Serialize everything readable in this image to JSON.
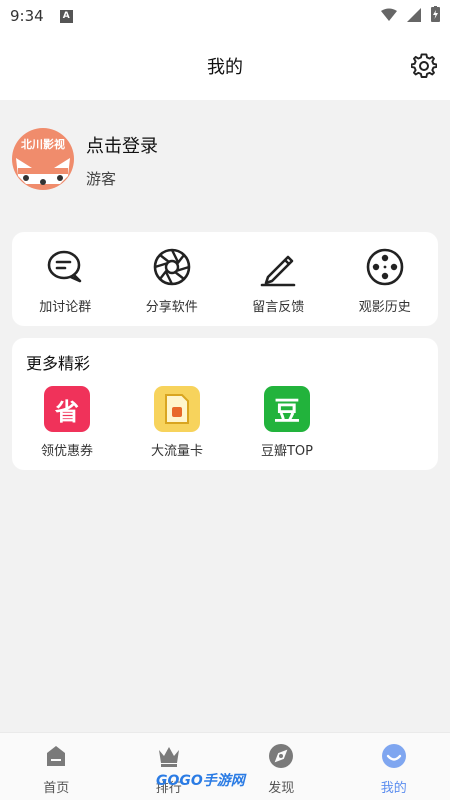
{
  "status": {
    "time": "9:34",
    "notif": "A"
  },
  "header": {
    "title": "我的"
  },
  "profile": {
    "avatar_text": "北川影视",
    "login": "点击登录",
    "guest": "游客"
  },
  "tools": [
    {
      "label": "加讨论群",
      "icon": "chat-icon"
    },
    {
      "label": "分享软件",
      "icon": "aperture-icon"
    },
    {
      "label": "留言反馈",
      "icon": "pencil-icon"
    },
    {
      "label": "观影历史",
      "icon": "film-reel-icon"
    }
  ],
  "more": {
    "title": "更多精彩",
    "items": [
      {
        "label": "领优惠券",
        "glyph": "省",
        "color": "#f0325a"
      },
      {
        "label": "大流量卡",
        "glyph": "",
        "color": "#f7d35c"
      },
      {
        "label": "豆瓣TOP",
        "glyph": "豆",
        "color": "#22b33c"
      }
    ]
  },
  "tabs": [
    {
      "label": "首页",
      "icon": "home-icon"
    },
    {
      "label": "排行",
      "icon": "crown-icon"
    },
    {
      "label": "发现",
      "icon": "discover-icon"
    },
    {
      "label": "我的",
      "icon": "smile-icon"
    }
  ],
  "watermark": "GOGO手游网"
}
